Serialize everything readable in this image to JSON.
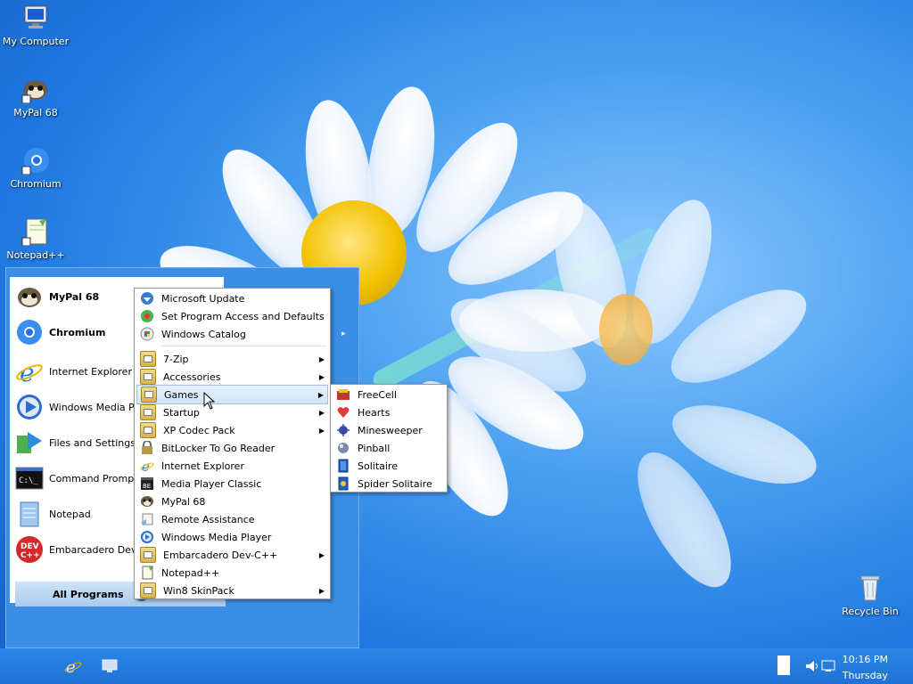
{
  "desktop": {
    "icons": [
      {
        "label": "My Computer",
        "icon": "computer-icon"
      },
      {
        "label": "MyPal 68",
        "icon": "mypal-icon"
      },
      {
        "label": "Chromium",
        "icon": "chromium-icon"
      },
      {
        "label": "Notepad++",
        "icon": "notepad-plus-icon"
      },
      {
        "label": "Recycle Bin",
        "icon": "recycle-bin-icon"
      }
    ]
  },
  "start_menu": {
    "pinned": [
      {
        "label": "MyPal 68",
        "bold": true,
        "icon": "mypal-icon"
      },
      {
        "label": "Chromium",
        "bold": true,
        "icon": "chromium-icon"
      },
      {
        "label": "Internet Explorer",
        "icon": "internet-explorer-icon"
      },
      {
        "label": "Windows Media Pl",
        "icon": "windows-media-player-icon"
      },
      {
        "label": "Files and Settings T",
        "icon": "files-settings-transfer-icon"
      },
      {
        "label": "Command Prompt",
        "icon": "command-prompt-icon"
      },
      {
        "label": "Notepad",
        "icon": "notepad-icon"
      },
      {
        "label": "Embarcadero Dev-C",
        "icon": "devcpp-icon"
      }
    ],
    "all_programs_label": "All Programs"
  },
  "programs_menu": {
    "items": [
      {
        "label": "Microsoft Update",
        "icon": "microsoft-update-icon",
        "submenu": false
      },
      {
        "label": "Set Program Access and Defaults",
        "icon": "program-defaults-icon",
        "submenu": false
      },
      {
        "label": "Windows Catalog",
        "icon": "windows-catalog-icon",
        "submenu": false
      },
      {
        "label": "7-Zip",
        "icon": "folder-icon",
        "submenu": true
      },
      {
        "label": "Accessories",
        "icon": "folder-icon",
        "submenu": true
      },
      {
        "label": "Games",
        "icon": "folder-icon",
        "submenu": true,
        "highlighted": true
      },
      {
        "label": "Startup",
        "icon": "folder-icon",
        "submenu": true
      },
      {
        "label": "XP Codec Pack",
        "icon": "folder-icon",
        "submenu": true
      },
      {
        "label": "BitLocker To Go Reader",
        "icon": "bitlocker-icon",
        "submenu": false
      },
      {
        "label": "Internet Explorer",
        "icon": "internet-explorer-icon",
        "submenu": false
      },
      {
        "label": "Media Player Classic",
        "icon": "media-player-classic-icon",
        "submenu": false
      },
      {
        "label": "MyPal 68",
        "icon": "mypal-icon",
        "submenu": false
      },
      {
        "label": "Remote Assistance",
        "icon": "remote-assistance-icon",
        "submenu": false
      },
      {
        "label": "Windows Media Player",
        "icon": "windows-media-player-icon",
        "submenu": false
      },
      {
        "label": "Embarcadero Dev-C++",
        "icon": "folder-icon",
        "submenu": true
      },
      {
        "label": "Notepad++",
        "icon": "notepad-plus-icon",
        "submenu": false
      },
      {
        "label": "Win8 SkinPack",
        "icon": "folder-icon",
        "submenu": true
      }
    ],
    "more_arrow": "▸"
  },
  "games_menu": {
    "items": [
      {
        "label": "FreeCell",
        "icon": "freecell-icon"
      },
      {
        "label": "Hearts",
        "icon": "hearts-icon"
      },
      {
        "label": "Minesweeper",
        "icon": "minesweeper-icon"
      },
      {
        "label": "Pinball",
        "icon": "pinball-icon"
      },
      {
        "label": "Solitaire",
        "icon": "solitaire-icon"
      },
      {
        "label": "Spider Solitaire",
        "icon": "spider-solitaire-icon"
      }
    ]
  },
  "taskbar": {
    "clock_time": "10:16 PM",
    "clock_day": "Thursday"
  }
}
